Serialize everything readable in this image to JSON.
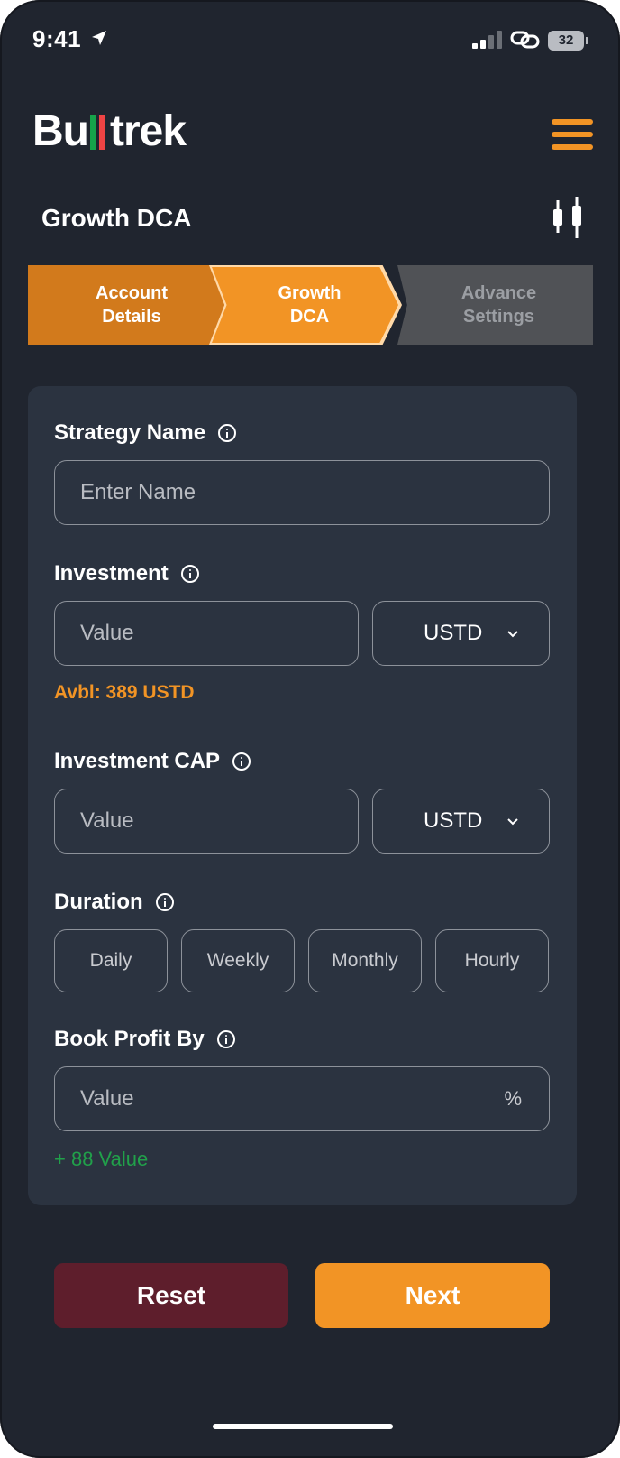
{
  "status_bar": {
    "time": "9:41",
    "battery": "32"
  },
  "header": {
    "logo_prefix": "Bu",
    "logo_suffix": "trek",
    "logo_bar_colors": [
      "#16a34a",
      "#ef4444"
    ],
    "menu_icon": "hamburger-icon",
    "page_title": "Growth DCA",
    "chart_icon": "candlestick-icon"
  },
  "stepper": {
    "steps": [
      {
        "line1": "Account",
        "line2": "Details",
        "state": "completed"
      },
      {
        "line1": "Growth",
        "line2": "DCA",
        "state": "active"
      },
      {
        "line1": "Advance",
        "line2": "Settings",
        "state": "pending"
      }
    ]
  },
  "form": {
    "strategy_name": {
      "label": "Strategy Name",
      "placeholder": "Enter Name"
    },
    "investment": {
      "label": "Investment",
      "placeholder": "Value",
      "currency": "USTD",
      "available": "Avbl: 389 USTD"
    },
    "investment_cap": {
      "label": "Investment CAP",
      "placeholder": "Value",
      "currency": "USTD"
    },
    "duration": {
      "label": "Duration",
      "options": [
        "Daily",
        "Weekly",
        "Monthly",
        "Hourly"
      ]
    },
    "book_profit": {
      "label": "Book Profit By",
      "placeholder": "Value",
      "unit": "%",
      "note": "+ 88 Value"
    }
  },
  "actions": {
    "reset_label": "Reset",
    "next_label": "Next"
  },
  "colors": {
    "accent": "#f29425",
    "background": "#20252f",
    "card": "#2b3340",
    "reset": "#5e1e2c",
    "success": "#21a04a"
  }
}
